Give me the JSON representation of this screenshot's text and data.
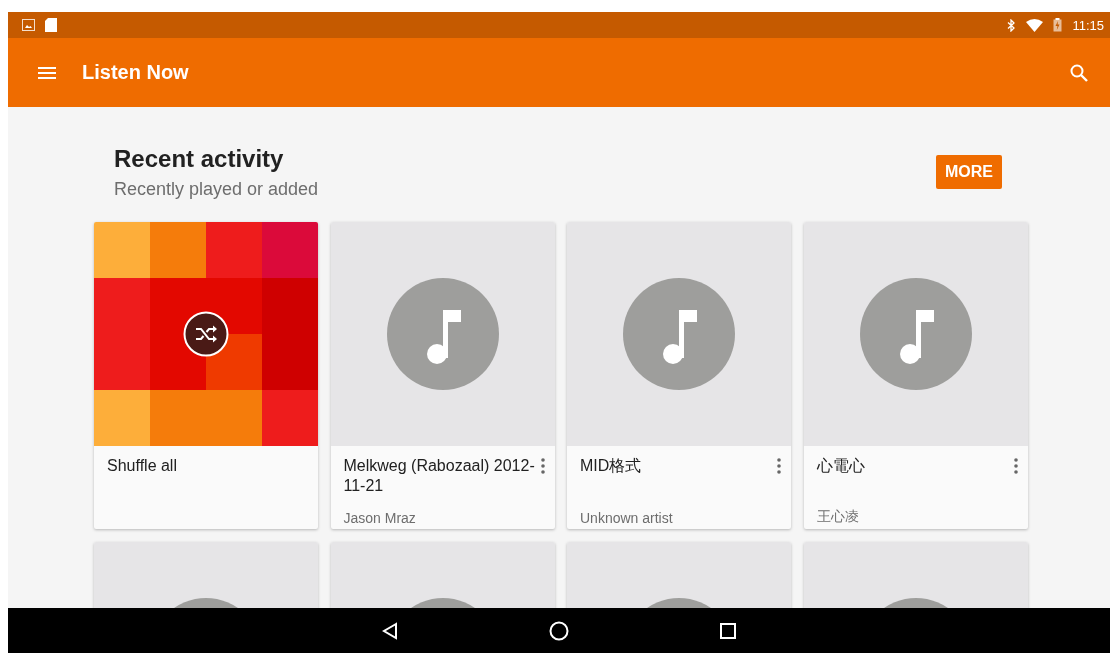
{
  "status_bar": {
    "time": "11:15"
  },
  "app_bar": {
    "title": "Listen Now"
  },
  "section": {
    "title": "Recent activity",
    "subtitle": "Recently played or added",
    "more_button": "MORE"
  },
  "cards": [
    {
      "kind": "shuffle",
      "title": "Shuffle all"
    },
    {
      "kind": "album",
      "title": "Melkweg (Rabozaal) 2012-11-21",
      "artist": "Jason Mraz"
    },
    {
      "kind": "album",
      "title": "MID格式",
      "artist": "Unknown artist"
    },
    {
      "kind": "album",
      "title": "心電心",
      "artist": "王心凌"
    },
    {
      "kind": "album"
    },
    {
      "kind": "album"
    },
    {
      "kind": "album"
    },
    {
      "kind": "album"
    }
  ]
}
